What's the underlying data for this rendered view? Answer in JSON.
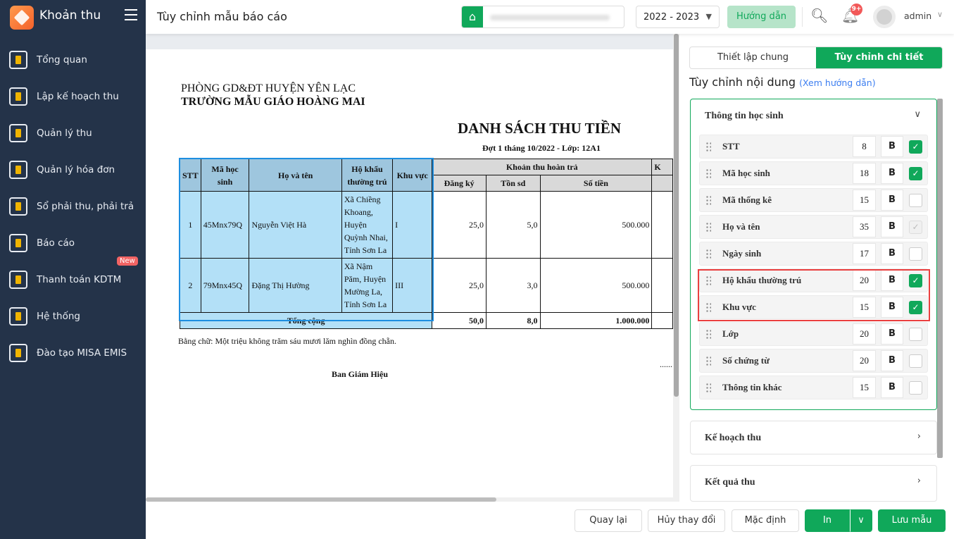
{
  "app": {
    "title": "Khoản thu"
  },
  "sidebar": {
    "items": [
      {
        "label": "Tổng quan",
        "icon": "bar-chart-icon"
      },
      {
        "label": "Lập kế hoạch thu",
        "icon": "calendar-dollar-icon"
      },
      {
        "label": "Quản lý thu",
        "icon": "hand-coin-icon"
      },
      {
        "label": "Quản lý hóa đơn",
        "icon": "document-icon"
      },
      {
        "label": "Sổ phải thu, phải trả",
        "icon": "ledger-icon"
      },
      {
        "label": "Báo cáo",
        "icon": "pie-chart-icon"
      },
      {
        "label": "Thanh toán KDTM",
        "icon": "card-payment-icon",
        "badge": "New"
      },
      {
        "label": "Hệ thống",
        "icon": "gear-icon"
      },
      {
        "label": "Đào tạo MISA EMIS",
        "icon": "book-icon"
      }
    ]
  },
  "header": {
    "page_title": "Tùy chỉnh mẫu báo cáo",
    "school_year": "2022 - 2023",
    "guide": "Hướng dẫn",
    "notif_count": "9+",
    "user": "admin"
  },
  "report": {
    "org": "PHÒNG GD&ĐT HUYỆN YÊN LẠC",
    "school": "TRƯỜNG MẪU GIÁO HOÀNG MAI",
    "title": "DANH SÁCH THU TIỀN",
    "subtitle": "Đợt 1 tháng 10/2022 - Lớp: 12A1",
    "headers": {
      "stt": "STT",
      "ma": "Mã học sinh",
      "ten": "Họ và tên",
      "hk": "Hộ khẩu thường trú",
      "kv": "Khu vực",
      "group": "Khoản thu hoàn trả",
      "dk": "Đăng ký",
      "ton": "Tồn sd",
      "tien": "Số tiền",
      "next": "K"
    },
    "rows": [
      {
        "stt": "1",
        "ma": "45Mnx79Q",
        "ten": "Nguyễn Việt Hà",
        "hk": "Xã Chiềng Khoang, Huyện Quỳnh Nhai, Tỉnh Sơn La",
        "kv": "I",
        "dk": "25,0",
        "ton": "5,0",
        "tien": "500.000"
      },
      {
        "stt": "2",
        "ma": "79Mnx45Q",
        "ten": "Đặng Thị Hường",
        "hk": "Xã Nậm Păm, Huyện Mường La, Tỉnh Sơn La",
        "kv": "III",
        "dk": "25,0",
        "ton": "3,0",
        "tien": "500.000"
      }
    ],
    "total": {
      "label": "Tổng cộng",
      "dk": "50,0",
      "ton": "8,0",
      "tien": "1.000.000"
    },
    "in_words": "Bằng chữ: Một triệu không trăm sáu mươi lăm nghìn đồng chẵn.",
    "dots": "......",
    "signature": "Ban Giám Hiệu"
  },
  "panel": {
    "tabs": [
      "Thiết lập chung",
      "Tùy chỉnh chi tiết"
    ],
    "section_title": "Tùy chỉnh nội dung",
    "guide_link": "(Xem hướng dẫn)",
    "groups": [
      {
        "title": "Thông tin học sinh"
      },
      {
        "title": "Kế hoạch thu"
      },
      {
        "title": "Kết quả thu"
      }
    ],
    "bold_label": "B",
    "fields": [
      {
        "name": "STT",
        "width": "8",
        "checked": true
      },
      {
        "name": "Mã học sinh",
        "width": "18",
        "checked": true
      },
      {
        "name": "Mã thống kê",
        "width": "15",
        "checked": false
      },
      {
        "name": "Họ và tên",
        "width": "35",
        "checked": true,
        "disabled": true
      },
      {
        "name": "Ngày sinh",
        "width": "17",
        "checked": false
      },
      {
        "name": "Hộ khẩu thường trú",
        "width": "20",
        "checked": true
      },
      {
        "name": "Khu vực",
        "width": "15",
        "checked": true
      },
      {
        "name": "Lớp",
        "width": "20",
        "checked": false
      },
      {
        "name": "Số chứng từ",
        "width": "20",
        "checked": false
      },
      {
        "name": "Thông tin khác",
        "width": "15",
        "checked": false
      }
    ]
  },
  "footer": {
    "back": "Quay lại",
    "cancel": "Hủy thay đổi",
    "default": "Mặc định",
    "print": "In",
    "save": "Lưu mẫu"
  },
  "colors": {
    "sidebar": "#243349",
    "accent": "#10a85a",
    "highlight": "#ea3f3f"
  }
}
